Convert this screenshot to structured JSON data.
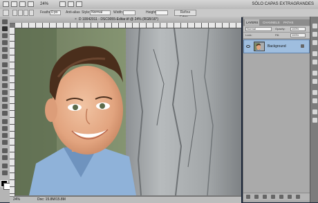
{
  "app": {
    "zoom": "24%",
    "workspace": "SÓLO CAPAS EXTRAGRANDES"
  },
  "options_bar": {
    "feather_label": "Feather:",
    "feather_value": "0 px",
    "antialias_label": "Anti-alias",
    "style_label": "Style:",
    "style_value": "Normal",
    "width_label": "Width:",
    "height_label": "Height:",
    "refine_edge_button": "Refine Edge..."
  },
  "document": {
    "tab_title": "D 10042011 - DSC0055-Editar.tif @ 24% (RGB/16*)",
    "status_zoom": "24%",
    "status_doc": "Doc: 15.8M/15.8M"
  },
  "layers_panel": {
    "tabs": [
      "LAYERS",
      "CHANNELS",
      "PATHS"
    ],
    "blend_mode": "Normal",
    "opacity_label": "Opacity:",
    "opacity_value": "100%",
    "lock_label": "Lock:",
    "fill_label": "Fill:",
    "fill_value": "100%",
    "layer_name": "Background"
  },
  "colors": {
    "selected_layer": "#9fbedf",
    "panel_bg": "#aaaaaa"
  }
}
